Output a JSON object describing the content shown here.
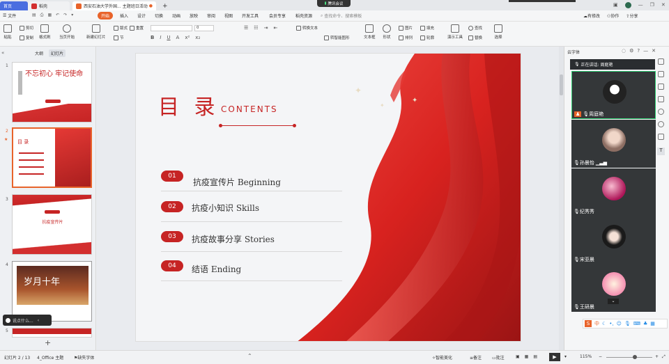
{
  "titlebar": {
    "tabs": [
      "首页",
      "稻壳",
      "西安石油大学外国...",
      "主题班日活动"
    ],
    "meeting": "腾讯会议",
    "add_tab": "+"
  },
  "menubar": {
    "file": "文件",
    "items": [
      "开始",
      "插入",
      "设计",
      "切换",
      "动画",
      "放映",
      "审阅",
      "视图",
      "开发工具",
      "会员专享",
      "稻壳资源"
    ],
    "search_placeholder": "查找命令、搜索模板",
    "right": [
      "有修改",
      "协作",
      "分享"
    ]
  },
  "ribbon": {
    "buttons": [
      "粘贴",
      "剪切",
      "复制",
      "格式刷",
      "当页开始",
      "新建幻灯片",
      "版式",
      "节",
      "重置",
      "文本框",
      "形状",
      "图片",
      "排列",
      "填充",
      "轮廓",
      "演示工具",
      "查找",
      "替换",
      "选择"
    ],
    "font_size": "0",
    "text_opts": [
      "转换文本",
      "转智能图形"
    ]
  },
  "leftpanel": {
    "tabs": [
      "大纲",
      "幻灯片"
    ],
    "slide_numbers": [
      "1",
      "2",
      "3",
      "4",
      "5"
    ],
    "thumb1_title": "不忘初心 牢记使命",
    "thumb3_title": "抗疫宣传片",
    "thumb4_title": "岁月十年",
    "add": "+",
    "popup": "说点什么..."
  },
  "slide": {
    "title": "目 录",
    "subtitle": "CONTENTS",
    "items": [
      {
        "num": "01",
        "text": "抗疫宣传片 Beginning"
      },
      {
        "num": "02",
        "text": "抗疫小知识 Skills"
      },
      {
        "num": "03",
        "text": "抗疫故事分享 Stories"
      },
      {
        "num": "04",
        "text": "结语 Ending"
      }
    ]
  },
  "rightpanel": {
    "header": "云字体",
    "speaking": "正在讲话: 周庭艳",
    "participants": [
      "周庭艳",
      "孙晨怡",
      "纪秀秀",
      "宋亚晨",
      "王研晨"
    ],
    "ime": "中"
  },
  "statusbar": {
    "slide": "幻灯片 2 / 13",
    "theme": "4_Office 主题",
    "font": "缺失字体",
    "smart": "智能美化",
    "notes": "备注",
    "comment": "批注",
    "zoom": "115%"
  },
  "colors": {
    "accent": "#c62424",
    "orange": "#e8632a"
  }
}
